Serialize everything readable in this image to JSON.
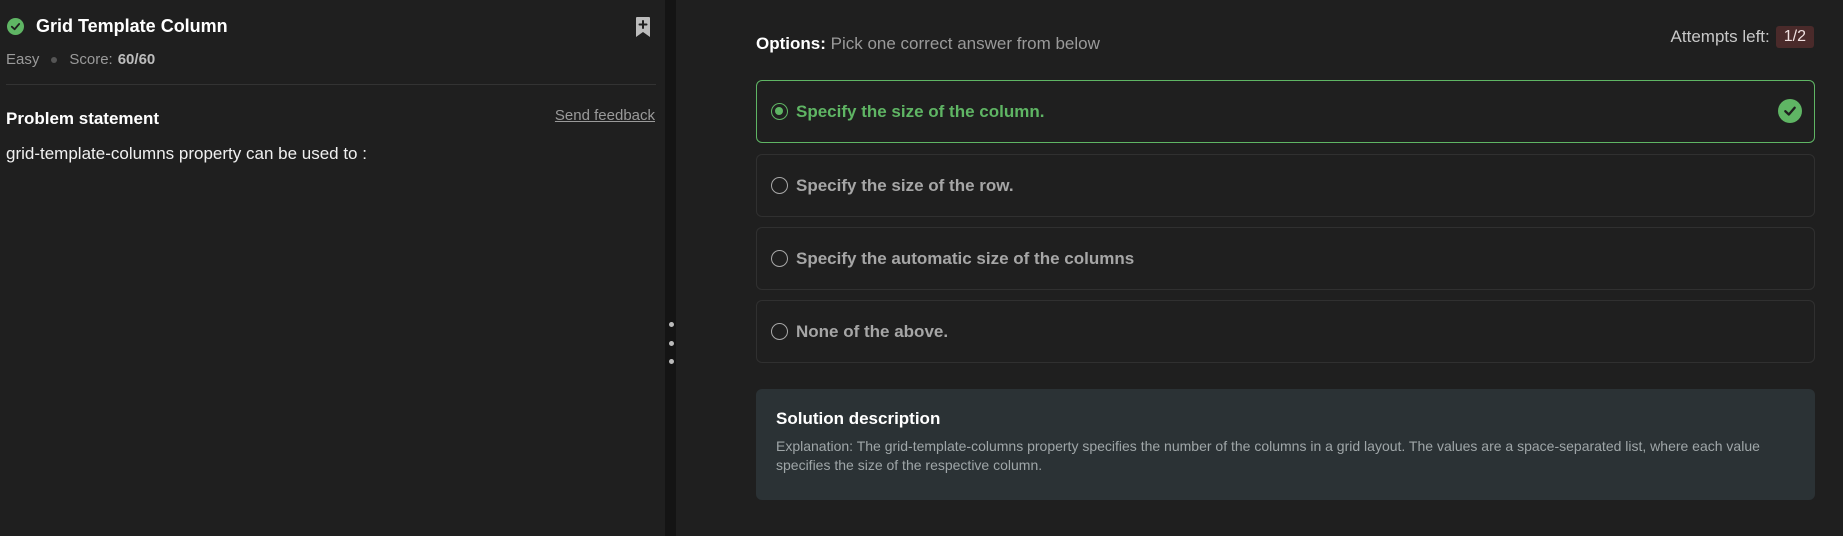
{
  "problem": {
    "title": "Grid Template Column",
    "difficulty": "Easy",
    "score_label": "Score:",
    "score_value": "60/60",
    "statement_title": "Problem statement",
    "feedback_link": "Send feedback",
    "statement": "grid-template-columns property can be used to :"
  },
  "options": {
    "label_bold": "Options:",
    "label_text": "Pick one correct answer from below",
    "attempts_label": "Attempts left:",
    "attempts_value": "1/2",
    "items": [
      {
        "label": "Specify the size of the column.",
        "selected": true,
        "correct": true
      },
      {
        "label": "Specify the size of the row.",
        "selected": false
      },
      {
        "label": "Specify the automatic size of the columns",
        "selected": false
      },
      {
        "label": "None of the above.",
        "selected": false
      }
    ]
  },
  "solution": {
    "title": "Solution description",
    "text": "Explanation: The grid-template-columns property specifies the number of the columns in a grid layout. The values are a space-separated list, where each value specifies the size of the respective column."
  },
  "colors": {
    "accent_green": "#5fb564",
    "background": "#1f1f1f",
    "solution_bg": "#2b3235",
    "attempts_badge": "#4a2a2a"
  },
  "icons": [
    "check-circle-icon",
    "bookmark-add-icon",
    "radio-icon",
    "drag-handle-icon"
  ]
}
